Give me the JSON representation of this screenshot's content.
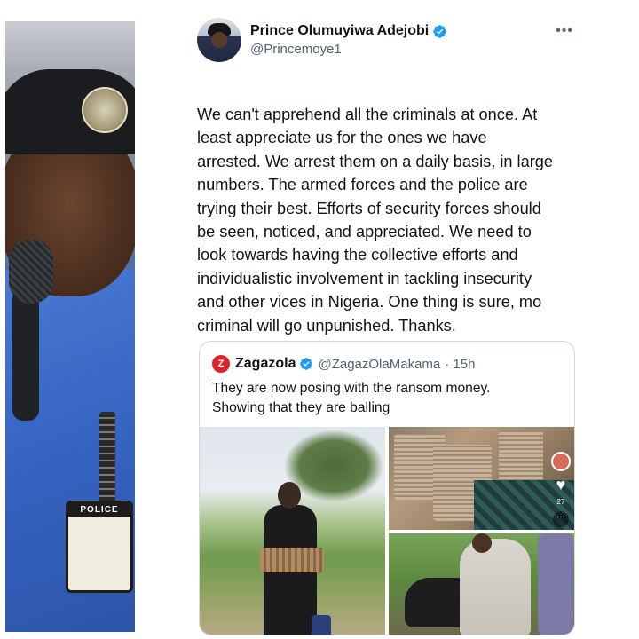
{
  "tweet": {
    "author_name": "Prince Olumuyiwa Adejobi",
    "author_handle": "@Princemoye1",
    "more_icon": "more-horizontal-icon",
    "body": "We can't apprehend all the criminals at once. At\nleast appreciate us for  the ones we have\narrested. We arrest them on a daily basis, in large\nnumbers. The armed forces and the police are\ntrying their best. Efforts of security forces should\nbe seen, noticed, and appreciated. We need to\nlook towards having the collective efforts and\nindividualistic involvement in  tackling insecurity\nand other vices in Nigeria. One thing is sure, mo\ncriminal will go unpunished. Thanks."
  },
  "quote": {
    "logo_text": "Z",
    "author_name": "Zagazola",
    "author_handle": "@ZagazOlaMakama",
    "time": "· 15h",
    "body": "They are now posing  with the ransom money.\nShowing that they are balling"
  },
  "photo": {
    "id_card_label": "POLICE"
  },
  "media_overlay": {
    "like_count": "27",
    "more_label": "···"
  },
  "colors": {
    "verified": "#1d9bf0",
    "text_primary": "#0f1419",
    "text_secondary": "#536471",
    "border": "#cfd9de",
    "zagazola_logo": "#d9252a"
  }
}
